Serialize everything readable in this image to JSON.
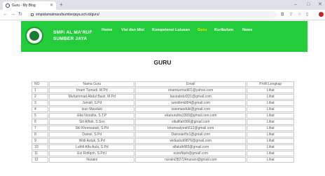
{
  "browser": {
    "tab_title": "Guru - My Blog",
    "url": "smpislamalmarufsumberjaya.sch.id/guru/"
  },
  "site": {
    "brand_line1": "SMPI AL MA'RUF",
    "brand_line2": "SUMBER JAYA",
    "nav": [
      {
        "label": "Home"
      },
      {
        "label": "Visi dan Misi"
      },
      {
        "label": "Kompetensi Lulusan"
      },
      {
        "label": "Guru"
      },
      {
        "label": "Kurikulum"
      },
      {
        "label": "News"
      }
    ],
    "active_nav": "Guru",
    "accent_color": "#23cc3a"
  },
  "page": {
    "title": "GURU"
  },
  "table": {
    "headers": [
      "NO",
      "Nama Guru",
      "Email",
      "Profil Lengkap"
    ],
    "rows": [
      {
        "no": "1",
        "nama": "Imam Tumudi, M.Pd",
        "email": "imamturmudi01@yahoo.com",
        "profil": "Lihat"
      },
      {
        "no": "2",
        "nama": "Muhammad Abdul Basir, M.Pd",
        "email": "basirabdul321@gmail.com",
        "profil": "Lihat"
      },
      {
        "no": "3",
        "nama": "Jumidi, S.Pd",
        "email": "jumidimidi94@gmail.com",
        "profil": "Lihat"
      },
      {
        "no": "4",
        "nama": "Izan Masduki",
        "email": "izanmasduki@gmail.com",
        "profil": "Lihat"
      },
      {
        "no": "5",
        "nama": "Eka Nurulita, S.T.P",
        "email": "ekanurulita1993@gmail.com.com",
        "profil": "Lihat"
      },
      {
        "no": "6",
        "nama": "Siti Alfiah, S.Sos",
        "email": "sitialfiah586@gmail.com",
        "profil": "Lihat"
      },
      {
        "no": "7",
        "nama": "Siti Khomsatah, S.Pd",
        "email": "khomsatyeah612@gmail.com",
        "profil": "Lihat"
      },
      {
        "no": "8",
        "nama": "Damsi, S.Pd",
        "email": "Damsiarifin1@gmail.com",
        "profil": "Lihat"
      },
      {
        "no": "9",
        "nama": "Widi Astuti, S.Pd",
        "email": "widiastuti9876@gmail.com",
        "profil": "Lihat"
      },
      {
        "no": "10",
        "nama": "Luthfi Alfa Aula, S.Pd",
        "email": "alfaluthfi83@gmail.com",
        "profil": "Lihat"
      },
      {
        "no": "11",
        "nama": "Evi Rofiqoh, S.Pd.I",
        "email": "evirofiqoh@gmail.com",
        "profil": "Lihat"
      },
      {
        "no": "12",
        "nama": "Nuraini",
        "email": "nuraini282724nuraini@gmail.com",
        "profil": "Lihat"
      }
    ]
  }
}
